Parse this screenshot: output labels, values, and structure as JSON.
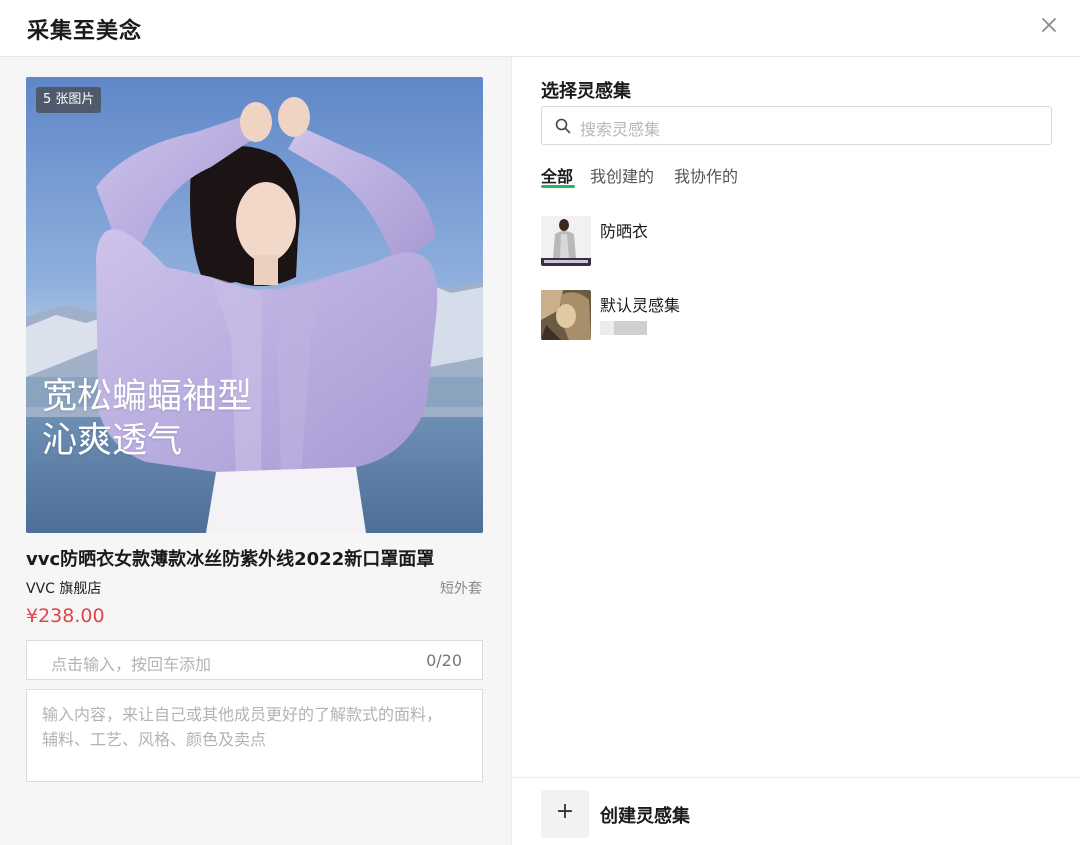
{
  "header": {
    "title": "采集至美念",
    "close_icon": "close-icon"
  },
  "product": {
    "image_count_badge": "5 张图片",
    "promo_line1": "宽松蝙蝠袖型",
    "promo_line2": "沁爽透气",
    "title": "vvc防晒衣女款薄款冰丝防紫外线2022新口罩面罩",
    "shop": "VVC 旗舰店",
    "category": "短外套",
    "price": "¥238.00",
    "price_color": "#e0454a",
    "tag_input": {
      "placeholder": "点击输入，按回车添加",
      "value": "",
      "counter": "0/20"
    },
    "note_input": {
      "placeholder": "输入内容，来让自己或其他成员更好的了解款式的面料，辅料、工艺、风格、颜色及卖点",
      "value": ""
    }
  },
  "collections_panel": {
    "title": "选择灵感集",
    "search": {
      "placeholder": "搜索灵感集",
      "icon": "search-icon"
    },
    "tabs": [
      {
        "label": "全部",
        "active": true
      },
      {
        "label": "我创建的",
        "active": false
      },
      {
        "label": "我协作的",
        "active": false
      }
    ],
    "accent_color": "#27b56b",
    "items": [
      {
        "name": "防晒衣"
      },
      {
        "name": "默认灵感集"
      }
    ]
  },
  "footer": {
    "add_icon": "plus-icon",
    "add_symbol": "+",
    "create_label": "创建灵感集"
  }
}
